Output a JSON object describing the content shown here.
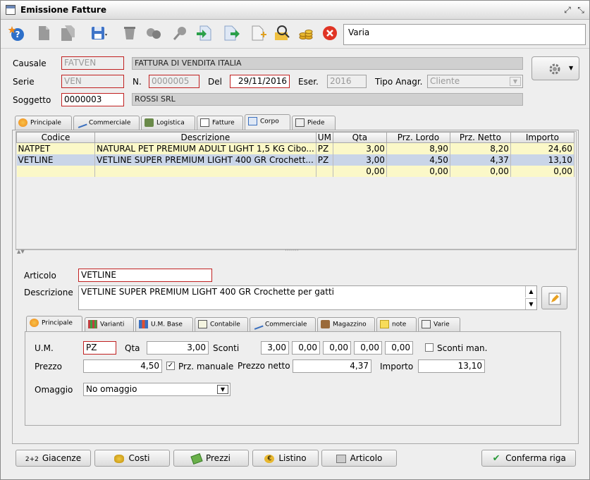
{
  "window": {
    "title": "Emissione Fatture"
  },
  "toolbar": {
    "info_text": "Varia",
    "icons": [
      "help-icon",
      "document-icon",
      "document-copy-icon",
      "save-icon",
      "delete-icon",
      "link-icon",
      "search-icon",
      "import-icon",
      "export-icon",
      "new-document-icon",
      "user-search-icon",
      "coins-icon",
      "cancel-icon"
    ]
  },
  "header": {
    "causale_label": "Causale",
    "causale_code": "FATVEN",
    "causale_desc": "FATTURA DI VENDITA ITALIA",
    "serie_label": "Serie",
    "serie_code": "VEN",
    "n_label": "N.",
    "n_value": "0000005",
    "del_label": "Del",
    "del_value": "29/11/2016",
    "eser_label": "Eser.",
    "eser_value": "2016",
    "tipo_label": "Tipo Anagr.",
    "tipo_value": "Cliente",
    "soggetto_label": "Soggetto",
    "soggetto_code": "0000003",
    "soggetto_desc": "ROSSI SRL"
  },
  "main_tabs": [
    {
      "label": "Principale"
    },
    {
      "label": "Commerciale"
    },
    {
      "label": "Logistica"
    },
    {
      "label": "Fatture"
    },
    {
      "label": "Corpo"
    },
    {
      "label": "Piede"
    }
  ],
  "grid": {
    "columns": [
      "Codice",
      "Descrizione",
      "UM",
      "Qta",
      "Prz. Lordo",
      "Prz. Netto",
      "Importo"
    ],
    "rows": [
      [
        "NATPET",
        "NATURAL PET PREMIUM ADULT LIGHT 1,5 KG Cibo...",
        "PZ",
        "3,00",
        "8,90",
        "8,20",
        "24,60"
      ],
      [
        "VETLINE",
        "VETLINE SUPER PREMIUM LIGHT 400 GR Crochett...",
        "PZ",
        "3,00",
        "4,50",
        "4,37",
        "13,10"
      ],
      [
        "",
        "",
        "",
        "0,00",
        "0,00",
        "0,00",
        "0,00"
      ]
    ]
  },
  "detail": {
    "articolo_label": "Articolo",
    "articolo_value": "VETLINE",
    "descrizione_label": "Descrizione",
    "descrizione_value": "VETLINE SUPER PREMIUM LIGHT 400 GR Crochette per gatti"
  },
  "sub_tabs": [
    {
      "label": "Principale"
    },
    {
      "label": "Varianti"
    },
    {
      "label": "U.M. Base"
    },
    {
      "label": "Contabile"
    },
    {
      "label": "Commerciale"
    },
    {
      "label": "Magazzino"
    },
    {
      "label": "note"
    },
    {
      "label": "Varie"
    }
  ],
  "principale": {
    "um_label": "U.M.",
    "um_value": "PZ",
    "qta_label": "Qta",
    "qta_value": "3,00",
    "sconti_label": "Sconti",
    "sconti": [
      "3,00",
      "0,00",
      "0,00",
      "0,00",
      "0,00"
    ],
    "sconti_man_label": "Sconti man.",
    "prezzo_label": "Prezzo",
    "prezzo_value": "4,50",
    "prz_manuale_label": "Prz. manuale",
    "prezzo_netto_label": "Prezzo netto",
    "prezzo_netto_value": "4,37",
    "importo_label": "Importo",
    "importo_value": "13,10",
    "omaggio_label": "Omaggio",
    "omaggio_value": "No omaggio"
  },
  "footer": {
    "giacenze_prefix": "2+2",
    "giacenze": "Giacenze",
    "costi": "Costi",
    "prezzi": "Prezzi",
    "listino": "Listino",
    "articolo": "Articolo",
    "conferma": "Conferma riga"
  }
}
